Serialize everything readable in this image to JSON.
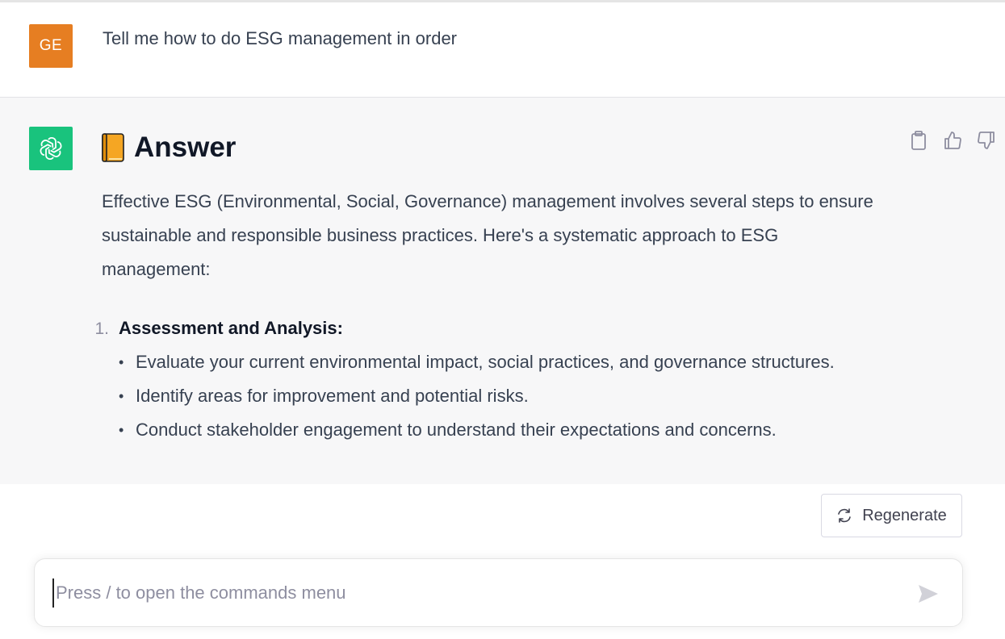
{
  "user": {
    "avatar_initials": "GE",
    "avatar_color": "#e67e22",
    "message": "Tell me how to do ESG management in order"
  },
  "assistant": {
    "avatar_icon": "openai-logo-icon",
    "avatar_color": "#19c37d",
    "heading_icon": "book-emoji-icon",
    "heading": "Answer",
    "actions": [
      {
        "name": "copy",
        "icon": "clipboard-icon"
      },
      {
        "name": "thumbs-up",
        "icon": "thumbs-up-icon"
      },
      {
        "name": "thumbs-down",
        "icon": "thumbs-down-icon"
      }
    ],
    "intro": "Effective ESG (Environmental, Social, Governance) management involves several steps to ensure sustainable and responsible business practices. Here's a systematic approach to ESG management:",
    "steps": [
      {
        "number": "1.",
        "title": "Assessment and Analysis:",
        "bullets": [
          "Evaluate your current environmental impact, social practices, and governance structures.",
          "Identify areas for improvement and potential risks.",
          "Conduct stakeholder engagement to understand their expectations and concerns."
        ]
      }
    ]
  },
  "controls": {
    "regenerate_label": "Regenerate",
    "regenerate_icon": "refresh-icon",
    "input_placeholder": "Press / to open the commands menu",
    "input_value": "",
    "send_icon": "send-icon"
  }
}
